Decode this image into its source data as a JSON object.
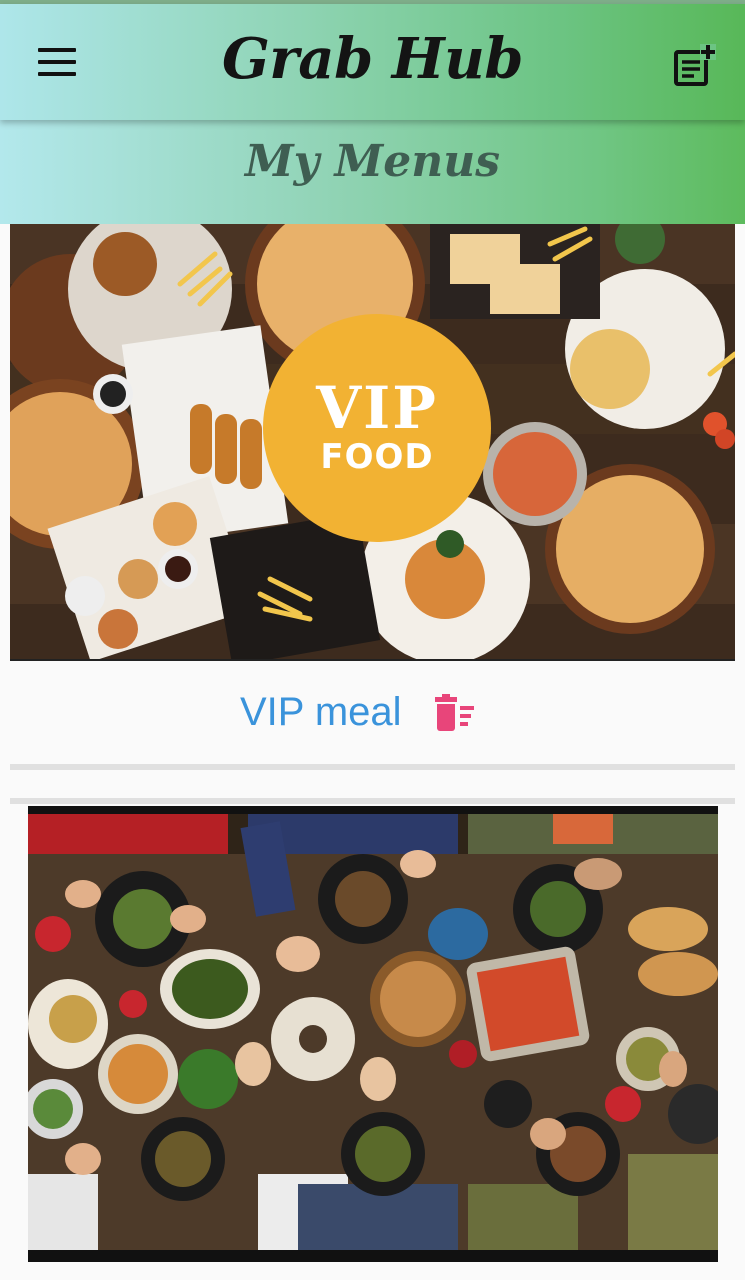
{
  "app_bar": {
    "title": "Grab Hub",
    "menu_icon": "hamburger-menu-icon",
    "action_icon": "note-add-icon"
  },
  "page": {
    "subtitle": "My Menus"
  },
  "menus": [
    {
      "badge_line1": "VIP",
      "badge_line2": "FOOD",
      "name": "VIP meal",
      "delete_icon": "delete-sweep-icon"
    }
  ],
  "colors": {
    "accent_blue": "#3a93db",
    "delete_pink": "#e8457a",
    "badge_gold": "#f2b233"
  }
}
